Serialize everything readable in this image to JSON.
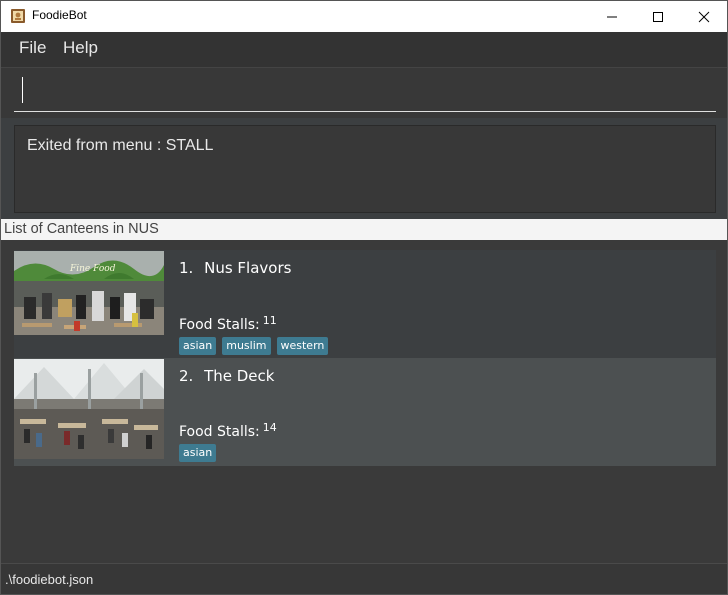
{
  "window": {
    "title": "FoodieBot",
    "icon": "app-icon"
  },
  "menu": {
    "file": "File",
    "help": "Help"
  },
  "command": {
    "value": "",
    "placeholder": ""
  },
  "result": {
    "text": "Exited from menu : STALL"
  },
  "list": {
    "header": "List of Canteens in NUS",
    "items": [
      {
        "index": "1.",
        "name": "Nus Flavors",
        "stalls_label": "Food Stalls:",
        "stalls_count": "11",
        "tags": [
          "asian",
          "muslim",
          "western"
        ],
        "image_sign": "Fine Food"
      },
      {
        "index": "2.",
        "name": "The Deck",
        "stalls_label": "Food Stalls:",
        "stalls_count": "14",
        "tags": [
          "asian"
        ]
      }
    ]
  },
  "status": {
    "file_path": ".\\foodiebot.json"
  },
  "colors": {
    "tag_bg": "#3e7b91",
    "background": "#3a3a3a",
    "selected_card": "#4c5051"
  }
}
